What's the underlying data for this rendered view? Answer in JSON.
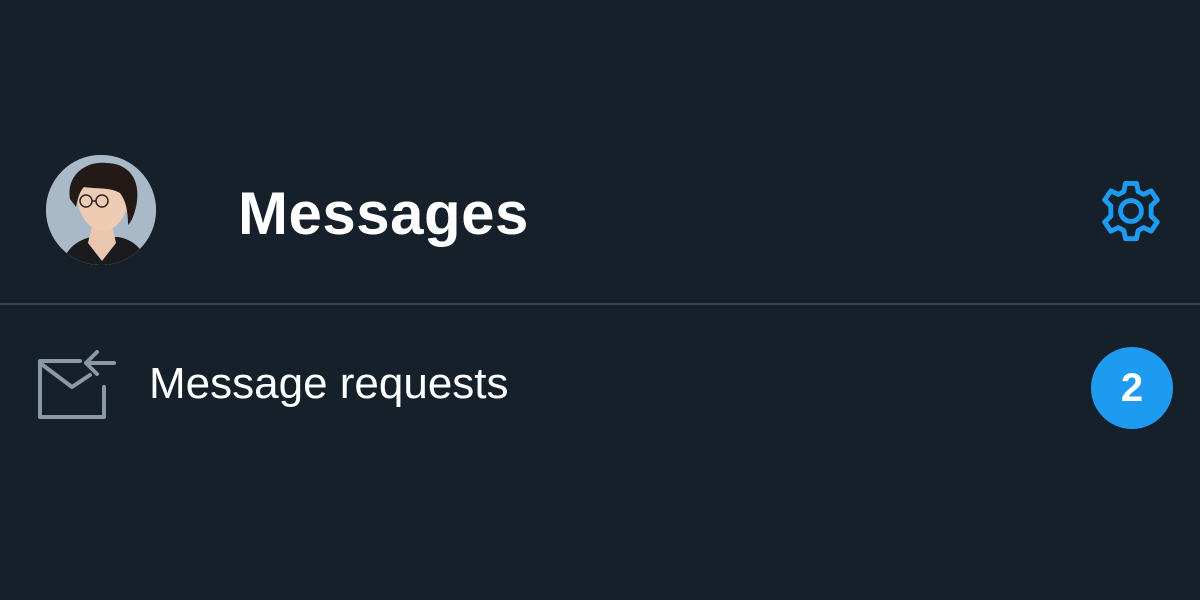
{
  "header": {
    "title": "Messages",
    "avatar_icon": "user-avatar",
    "settings_icon": "gear-icon"
  },
  "requests": {
    "label": "Message requests",
    "icon": "envelope-arrow-icon",
    "count": "2"
  },
  "colors": {
    "background": "#15202b",
    "accent": "#1d9bf0",
    "divider": "#38444d",
    "icon_gray": "#8b98a5",
    "text": "#ffffff"
  }
}
